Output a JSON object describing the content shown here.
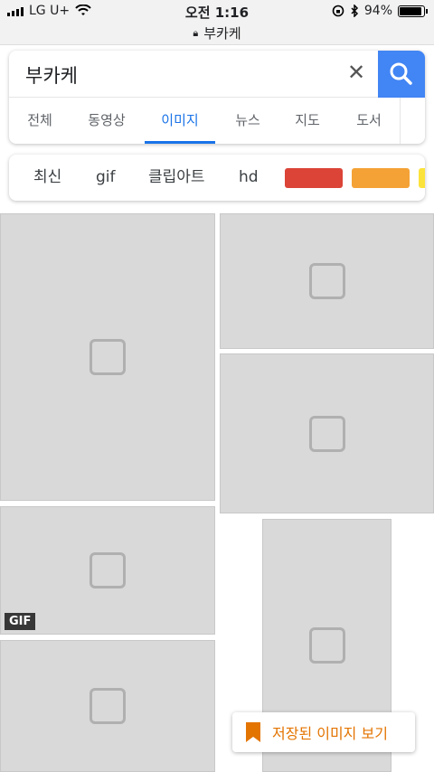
{
  "status_bar": {
    "carrier": "LG U+",
    "time": "오전 1:16",
    "battery": "94%",
    "battery_level": 0.94
  },
  "url_bar": {
    "domain_text": "부카케"
  },
  "search": {
    "query": "부카케",
    "clear_icon": "close-icon",
    "search_icon": "search-icon",
    "accent_color": "#4285f4"
  },
  "tabs": [
    "전체",
    "동영상",
    "이미지",
    "뉴스",
    "지도",
    "도서"
  ],
  "active_tab": "이미지",
  "chips": {
    "labels": [
      "최신",
      "gif",
      "클립아트",
      "hd"
    ],
    "color_swatches": [
      "#db4437",
      "#f4a236",
      "#fbe33b"
    ]
  },
  "results": {
    "gif_badge": "GIF"
  },
  "saved_images_button": {
    "label": "저장된 이미지 보기",
    "icon": "bookmark-icon"
  }
}
